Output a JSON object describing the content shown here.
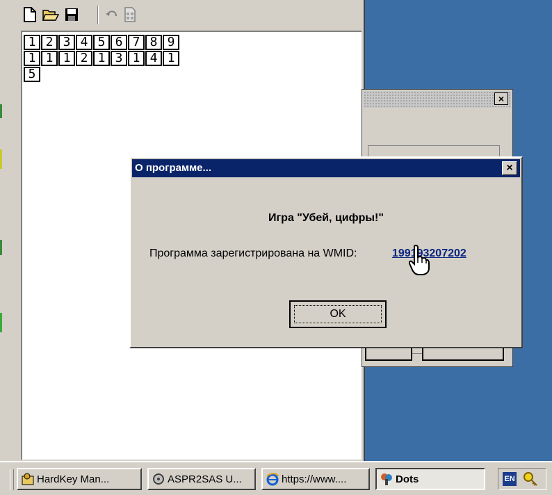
{
  "main_window": {
    "toolbar": {
      "buttons": [
        {
          "name": "new-file-icon"
        },
        {
          "name": "open-folder-icon"
        },
        {
          "name": "save-icon"
        },
        {
          "name": "undo-icon"
        },
        {
          "name": "calculator-icon"
        }
      ]
    },
    "grid": {
      "rows": [
        [
          "1",
          "2",
          "3",
          "4",
          "5",
          "6",
          "7",
          "8",
          "9"
        ],
        [
          "1",
          "1",
          "1",
          "2",
          "1",
          "3",
          "1",
          "4",
          "1"
        ],
        [
          "5"
        ]
      ]
    }
  },
  "background_dialog": {
    "close_glyph": "×"
  },
  "about_dialog": {
    "title": "О программе...",
    "close_glyph": "×",
    "heading": "Игра \"Убей, цифры!\"",
    "registered_label": "Программа зарегистрирована на WMID:",
    "wmid_link": "199193207202",
    "ok_label": "OK"
  },
  "taskbar": {
    "tasks": [
      {
        "label": "HardKey Man...",
        "icon": "folder-key-icon"
      },
      {
        "label": "ASPR2SAS U...",
        "icon": "gear-disk-icon"
      },
      {
        "label": "https://www....",
        "icon": "internet-explorer-icon"
      },
      {
        "label": "Dots",
        "icon": "dots-app-icon",
        "active": true
      }
    ],
    "tray": {
      "language": "EN",
      "icon": "key-tray-icon"
    }
  },
  "colors": {
    "desktop": "#3a6ea5",
    "title_bar": "#0a246a",
    "face": "#d4d0c8",
    "link": "#0a2480"
  }
}
